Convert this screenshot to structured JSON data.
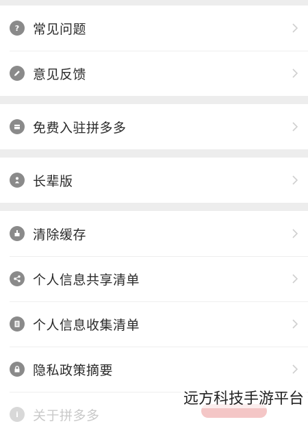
{
  "groups": [
    {
      "items": [
        {
          "label": "常见问题",
          "icon": "question-icon"
        },
        {
          "label": "意见反馈",
          "icon": "pencil-icon"
        }
      ]
    },
    {
      "items": [
        {
          "label": "免费入驻拼多多",
          "icon": "store-icon"
        }
      ]
    },
    {
      "items": [
        {
          "label": "长辈版",
          "icon": "elder-icon"
        }
      ]
    },
    {
      "items": [
        {
          "label": "清除缓存",
          "icon": "broom-icon"
        },
        {
          "label": "个人信息共享清单",
          "icon": "share-icon"
        },
        {
          "label": "个人信息收集清单",
          "icon": "list-icon"
        },
        {
          "label": "隐私政策摘要",
          "icon": "lock-icon"
        },
        {
          "label": "关于拼多多",
          "icon": "info-icon"
        }
      ]
    }
  ],
  "watermark": "远方科技手游平台",
  "colors": {
    "icon": "#8a8a8a",
    "text": "#2a2a2a",
    "chevron": "#cfcfcf",
    "bg": "#ededed"
  }
}
